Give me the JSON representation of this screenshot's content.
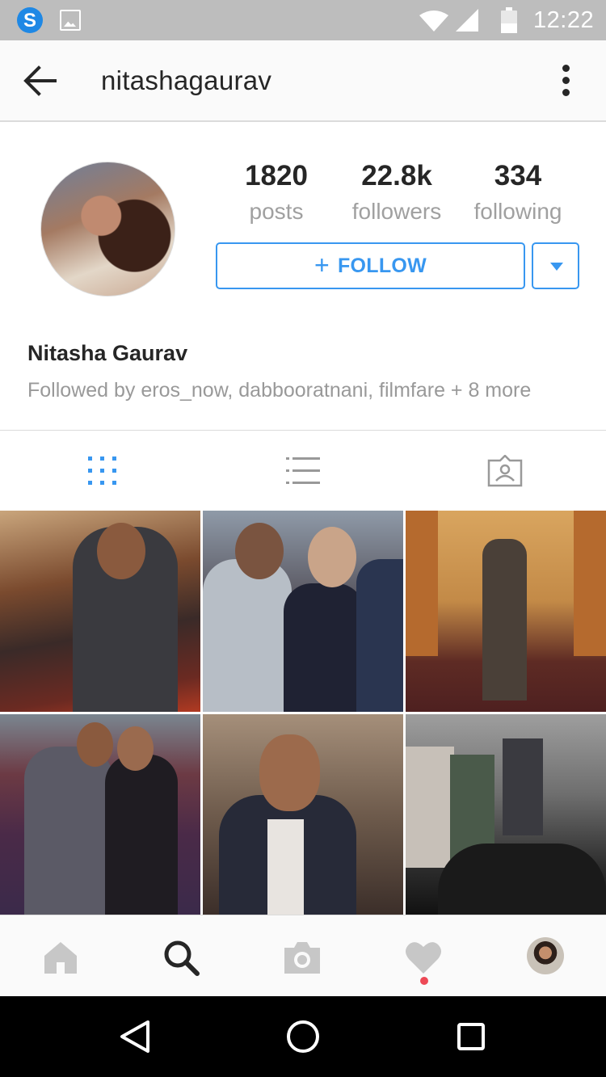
{
  "status_bar": {
    "time": "12:22",
    "icons": [
      "skype-icon",
      "image-icon",
      "wifi-icon",
      "signal-icon",
      "battery-icon"
    ]
  },
  "header": {
    "username": "nitashagaurav",
    "icons": [
      "back-arrow-icon",
      "more-vertical-icon"
    ]
  },
  "profile": {
    "stats": [
      {
        "value": "1820",
        "label": "posts"
      },
      {
        "value": "22.8k",
        "label": "followers"
      },
      {
        "value": "334",
        "label": "following"
      }
    ],
    "follow_label": "FOLLOW",
    "follow_plus": "+",
    "full_name": "Nitasha Gaurav",
    "followed_by": "Followed by eros_now, dabbooratnani, filmfare + 8 more"
  },
  "tabs": {
    "items": [
      "grid-view-icon",
      "list-view-icon",
      "tagged-photos-icon"
    ],
    "active_color": "#3897f0",
    "inactive_color": "#999999"
  },
  "bottom_nav": {
    "items": [
      "home-icon",
      "search-icon",
      "camera-icon",
      "heart-icon",
      "profile-avatar"
    ],
    "notification_color": "#ed4956"
  },
  "android_nav": {
    "items": [
      "back-triangle-icon",
      "home-circle-icon",
      "recents-square-icon"
    ]
  },
  "colors": {
    "accent": "#3897f0",
    "status_bar": "#bdbdbd",
    "text_primary": "#262626",
    "text_secondary": "#999999"
  }
}
